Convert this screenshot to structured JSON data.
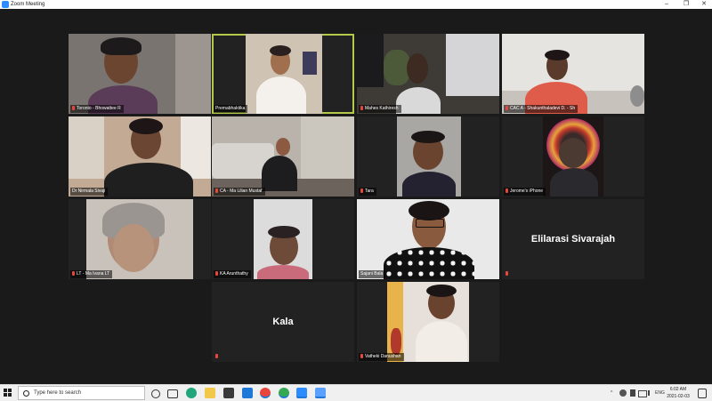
{
  "window": {
    "title": "Zoom Meeting",
    "minimize": "–",
    "maximize": "❐",
    "close": "✕"
  },
  "participants": [
    {
      "name": "Toronto - Bhowattee R"
    },
    {
      "name": "Premabhaktika"
    },
    {
      "name": "Mahes Kathiresh"
    },
    {
      "name": "CAC A - Shakunthaladevi D. - Sh"
    },
    {
      "name": "Dr Nirmala Sivaji"
    },
    {
      "name": "CA - Ma Lilian Mustaf"
    },
    {
      "name": "Tara"
    },
    {
      "name": "Jerome's iPhone"
    },
    {
      "name": "LT - Ma Ivana LT"
    },
    {
      "name": "KA Arunthathy"
    },
    {
      "name": "Sajani Bala"
    },
    {
      "name": "Elilarasi Sivarajah",
      "display": "Elilarasi Sivarajah"
    },
    {
      "name": "Kala",
      "display": "Kala"
    },
    {
      "name": "Vatheki Danushan"
    }
  ],
  "active_speaker_color": "#b4c94a",
  "taskbar": {
    "search_placeholder": "Type here to search",
    "apps": [
      "task-view",
      "edge",
      "file-explorer",
      "store",
      "mail",
      "chrome-alt",
      "chrome",
      "zoom",
      "zoom-meeting"
    ],
    "tray": {
      "chevron": "^",
      "lang": "ENG",
      "time": "6:02 AM",
      "date": "2021-02-03"
    }
  }
}
